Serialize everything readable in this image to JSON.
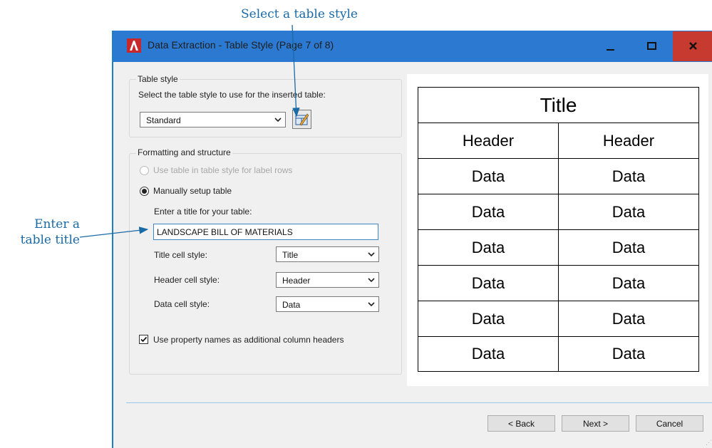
{
  "callouts": {
    "top": "Select a table style",
    "left_line1": "Enter a",
    "left_line2": "table title"
  },
  "window": {
    "title": "Data Extraction - Table Style (Page 7 of 8)",
    "app_icon": "autocad-a-icon",
    "controls": [
      "minimize-icon",
      "maximize-icon",
      "close-icon"
    ]
  },
  "table_style": {
    "group_label": "Table style",
    "prompt": "Select the table style to use for the inserted table:",
    "selected": "Standard",
    "launch_icon": "table-style-dialog-icon"
  },
  "formatting": {
    "group_label": "Formatting and structure",
    "option_label_rows": "Use table in table style for label rows",
    "option_manual": "Manually setup table",
    "option_manual_selected": true,
    "title_prompt": "Enter a title for your table:",
    "title_value": "LANDSCAPE BILL OF MATERIALS",
    "title_cell_label": "Title cell style:",
    "title_cell_value": "Title",
    "header_cell_label": "Header cell style:",
    "header_cell_value": "Header",
    "data_cell_label": "Data cell style:",
    "data_cell_value": "Data",
    "property_names_label": "Use property names as additional column headers",
    "property_names_checked": true
  },
  "preview": {
    "title": "Title",
    "headers": [
      "Header",
      "Header"
    ],
    "rows": [
      [
        "Data",
        "Data"
      ],
      [
        "Data",
        "Data"
      ],
      [
        "Data",
        "Data"
      ],
      [
        "Data",
        "Data"
      ],
      [
        "Data",
        "Data"
      ],
      [
        "Data",
        "Data"
      ]
    ]
  },
  "buttons": {
    "back": "< Back",
    "next": "Next >",
    "cancel": "Cancel"
  },
  "colors": {
    "titlebar": "#2b79d0",
    "close": "#c63a30",
    "callout": "#1a6aa6"
  }
}
